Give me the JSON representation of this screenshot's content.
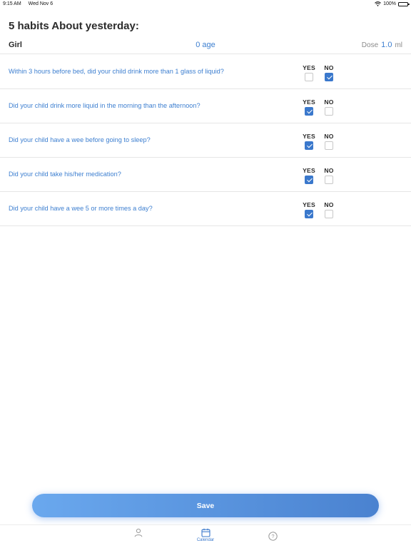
{
  "status_bar": {
    "time": "9:15 AM",
    "date": "Wed Nov 6",
    "battery": "100%"
  },
  "title": "5 habits About yesterday:",
  "info": {
    "gender": "Girl",
    "age_value": "0",
    "age_unit": "age",
    "dose_label": "Dose",
    "dose_value": "1.0",
    "dose_unit": "ml"
  },
  "options": {
    "yes": "YES",
    "no": "NO"
  },
  "questions": [
    {
      "text": "Within 3 hours before bed, did your child drink more than 1 glass of liquid?",
      "answer": "no"
    },
    {
      "text": "Did your child drink more liquid in the morning than the afternoon?",
      "answer": "yes"
    },
    {
      "text": "Did your child have a wee before going to sleep?",
      "answer": "yes"
    },
    {
      "text": "Did your child take his/her medication?",
      "answer": "yes"
    },
    {
      "text": "Did your child have a wee 5 or more times a day?",
      "answer": "yes"
    }
  ],
  "save_label": "Save",
  "tabs": [
    {
      "label": "",
      "icon": "person-icon",
      "active": false
    },
    {
      "label": "Calendar",
      "icon": "calendar-icon",
      "active": true
    },
    {
      "label": "",
      "icon": "help-icon",
      "active": false
    }
  ],
  "colors": {
    "accent": "#3d7fd0",
    "checked": "#3a78cc",
    "text": "#2b2b2b"
  }
}
